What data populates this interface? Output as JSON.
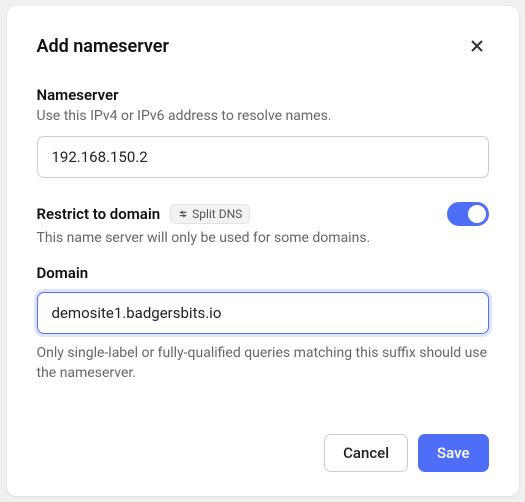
{
  "dialog": {
    "title": "Add nameserver"
  },
  "nameserver": {
    "title": "Nameserver",
    "desc": "Use this IPv4 or IPv6 address to resolve names.",
    "value": "192.168.150.2"
  },
  "restrict": {
    "title": "Restrict to domain",
    "badge": "Split DNS",
    "desc": "This name server will only be used for some domains.",
    "enabled": true
  },
  "domain": {
    "title": "Domain",
    "value": "demosite1.badgersbits.io",
    "desc": "Only single-label or fully-qualified queries matching this suffix should use the nameserver."
  },
  "footer": {
    "cancel": "Cancel",
    "save": "Save"
  }
}
